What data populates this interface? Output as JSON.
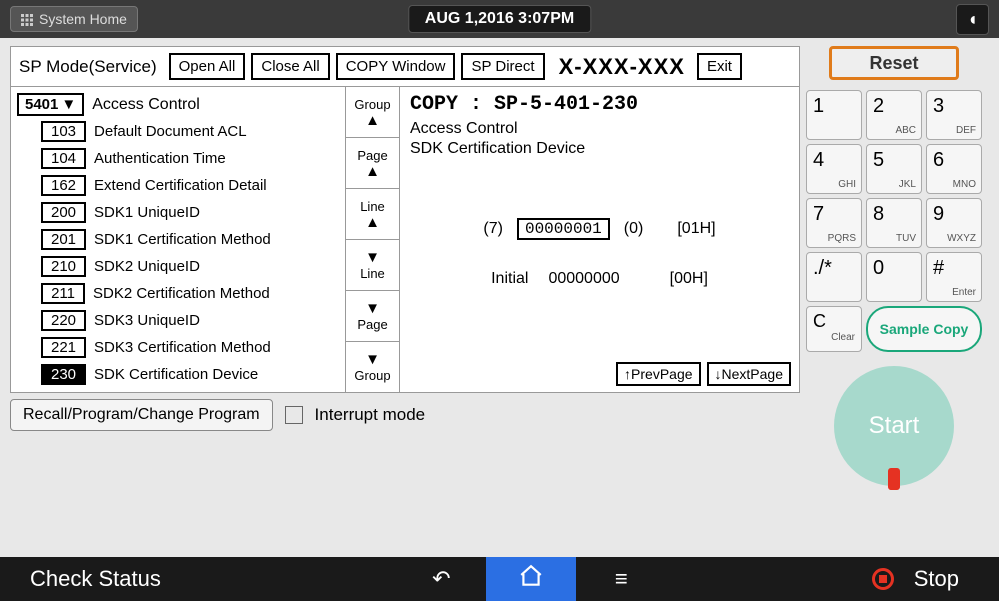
{
  "topbar": {
    "home_label": "System Home",
    "datetime": "AUG  1,2016  3:07PM"
  },
  "sp_header": {
    "title": "SP Mode(Service)",
    "open_all": "Open All",
    "close_all": "Close All",
    "copy_window": "COPY Window",
    "sp_direct": "SP Direct",
    "code": "X-XXX-XXX",
    "exit": "Exit"
  },
  "main_item": {
    "code": "5401",
    "label": "Access Control"
  },
  "sub_items": [
    {
      "code": "103",
      "label": "Default Document ACL"
    },
    {
      "code": "104",
      "label": "Authentication Time"
    },
    {
      "code": "162",
      "label": "Extend Certification Detail"
    },
    {
      "code": "200",
      "label": "SDK1 UniqueID"
    },
    {
      "code": "201",
      "label": "SDK1 Certification Method"
    },
    {
      "code": "210",
      "label": "SDK2 UniqueID"
    },
    {
      "code": "211",
      "label": "SDK2 Certification Method"
    },
    {
      "code": "220",
      "label": "SDK3 UniqueID"
    },
    {
      "code": "221",
      "label": "SDK3 Certification Method"
    },
    {
      "code": "230",
      "label": "SDK Certification Device",
      "active": true
    }
  ],
  "nav": {
    "group": "Group",
    "page": "Page",
    "line": "Line"
  },
  "detail": {
    "copy_line": "COPY : SP-5-401-230",
    "line1": "Access Control",
    "line2": "SDK Certification Device",
    "bits_left": "(7)",
    "value": "00000001",
    "bits_right": "(0)",
    "hex": "[01H]",
    "init_label": "Initial",
    "init_value": "00000000",
    "init_hex": "[00H]",
    "prev": "↑PrevPage",
    "next": "↓NextPage"
  },
  "under": {
    "recall": "Recall/Program/Change Program",
    "interrupt": "Interrupt mode"
  },
  "keypad": {
    "reset": "Reset",
    "keys": [
      {
        "k": "1",
        "s": ""
      },
      {
        "k": "2",
        "s": "ABC"
      },
      {
        "k": "3",
        "s": "DEF"
      },
      {
        "k": "4",
        "s": "GHI"
      },
      {
        "k": "5",
        "s": "JKL"
      },
      {
        "k": "6",
        "s": "MNO"
      },
      {
        "k": "7",
        "s": "PQRS"
      },
      {
        "k": "8",
        "s": "TUV"
      },
      {
        "k": "9",
        "s": "WXYZ"
      },
      {
        "k": "./*",
        "s": ""
      },
      {
        "k": "0",
        "s": ""
      },
      {
        "k": "#",
        "s": "Enter"
      }
    ],
    "clear": "C",
    "clear_sub": "Clear",
    "sample": "Sample Copy",
    "start": "Start"
  },
  "bottom": {
    "check": "Check Status",
    "stop": "Stop"
  }
}
